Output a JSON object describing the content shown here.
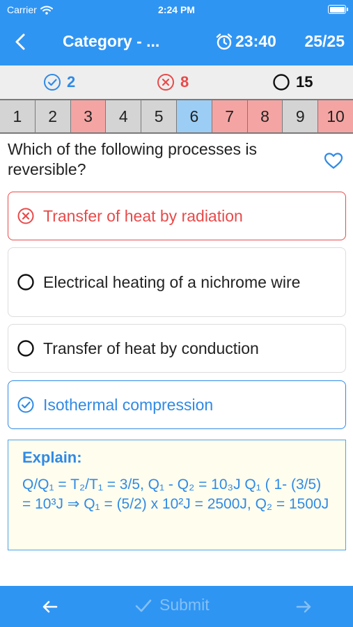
{
  "status_bar": {
    "carrier": "Carrier",
    "time": "2:24 PM"
  },
  "nav": {
    "title": "Category - ...",
    "timer": "23:40",
    "progress": "25/25"
  },
  "stats": {
    "correct": "2",
    "wrong": "8",
    "unanswered": "15"
  },
  "question_nav": [
    {
      "label": "1",
      "state": "gray"
    },
    {
      "label": "2",
      "state": "gray"
    },
    {
      "label": "3",
      "state": "red"
    },
    {
      "label": "4",
      "state": "gray"
    },
    {
      "label": "5",
      "state": "gray"
    },
    {
      "label": "6",
      "state": "blue"
    },
    {
      "label": "7",
      "state": "red"
    },
    {
      "label": "8",
      "state": "red"
    },
    {
      "label": "9",
      "state": "gray"
    },
    {
      "label": "10",
      "state": "red"
    }
  ],
  "question": {
    "text": "Which of the following processes is reversible?"
  },
  "options": [
    {
      "text": "Transfer of heat by radiation",
      "state": "wrong"
    },
    {
      "text": "Electrical heating of a nichrome wire",
      "state": "none"
    },
    {
      "text": "Transfer of heat by conduction",
      "state": "none"
    },
    {
      "text": "Isothermal compression",
      "state": "correct"
    }
  ],
  "explain": {
    "title": "Explain:",
    "text": "Q/Q₁ = T₂/T₁ = 3/5, Q₁ - Q₂ = 10₃J Q₁ ( 1- (3/5) = 10³J ⇒ Q₁ = (5/2) x 10²J = 2500J, Q₂ = 1500J"
  },
  "bottom": {
    "submit_label": "Submit"
  },
  "colors": {
    "primary": "#2f95f3",
    "correct": "#2f8ae5",
    "wrong": "#e84a4a",
    "explain_bg": "#fffdee"
  }
}
